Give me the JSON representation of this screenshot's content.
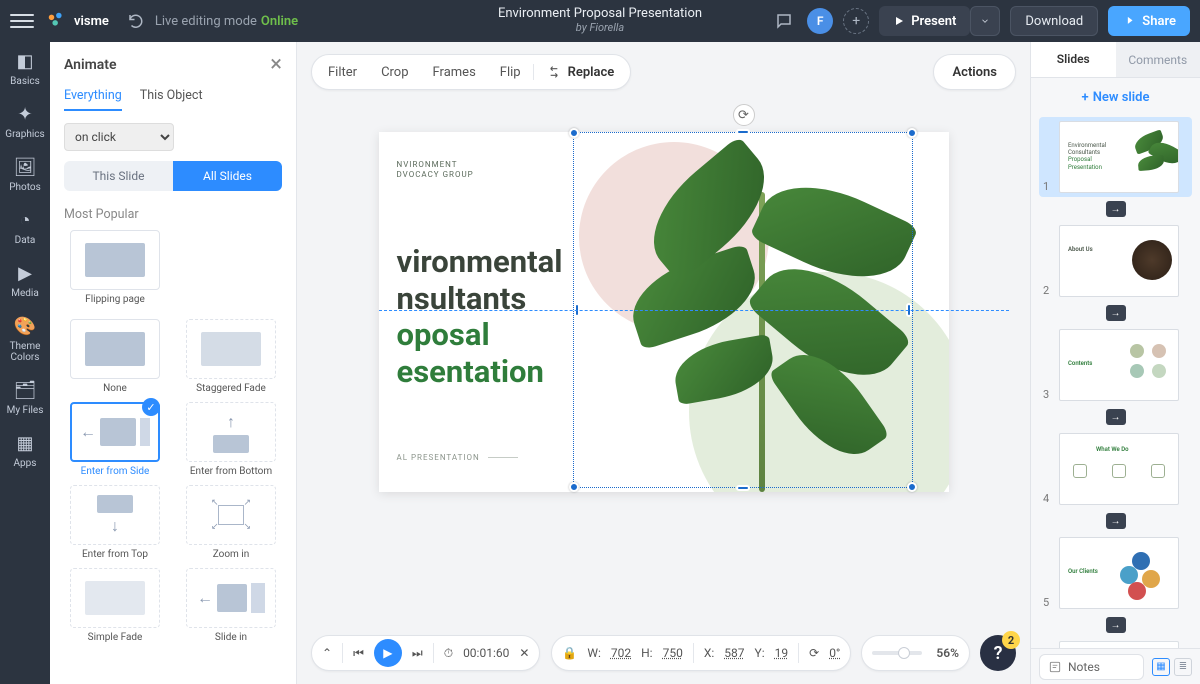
{
  "topbar": {
    "logo": "visme",
    "editing_mode_label": "Live editing mode",
    "editing_mode_status": "Online",
    "title": "Environment Proposal Presentation",
    "by_line": "by Fiorella",
    "avatar_initial": "F",
    "present": "Present",
    "download": "Download",
    "share": "Share"
  },
  "leftrail": {
    "items": [
      "Basics",
      "Graphics",
      "Photos",
      "Data",
      "Media",
      "Theme Colors",
      "My Files",
      "Apps"
    ]
  },
  "animate": {
    "head": "Animate",
    "tabs": {
      "everything": "Everything",
      "this_object": "This Object"
    },
    "trigger": "on click",
    "scope_this": "This Slide",
    "scope_all": "All Slides",
    "most_popular": "Most Popular",
    "cards": {
      "flipping": "Flipping page",
      "none": "None",
      "staggered": "Staggered Fade",
      "enter_side": "Enter from Side",
      "enter_bottom": "Enter from Bottom",
      "enter_top": "Enter from Top",
      "zoom_in": "Zoom in",
      "simple_fade": "Simple Fade",
      "slide_in": "Slide in"
    }
  },
  "toolbar": {
    "filter": "Filter",
    "crop": "Crop",
    "frames": "Frames",
    "flip": "Flip",
    "replace": "Replace",
    "actions": "Actions"
  },
  "slide": {
    "sub_line1": "NVIRONMENT",
    "sub_line2": "DVOCACY GROUP",
    "title1": "vironmental",
    "title2": "nsultants",
    "title3": "oposal",
    "title4": "esentation",
    "footer": "AL PRESENTATION"
  },
  "bottom": {
    "timer": "00:01:60",
    "w_label": "W:",
    "w_val": "702",
    "h_label": "H:",
    "h_val": "750",
    "x_label": "X:",
    "x_val": "587",
    "y_label": "Y:",
    "y_val": "19",
    "rot": "0°",
    "zoom": "56%",
    "help_badge": "2"
  },
  "right": {
    "tab_slides": "Slides",
    "tab_comments": "Comments",
    "new_slide": "New slide",
    "notes": "Notes",
    "slide_nums": [
      "1",
      "2",
      "3",
      "4",
      "5"
    ],
    "t1_l1": "Environmental",
    "t1_l2": "Consultants",
    "t1_l3": "Proposal",
    "t1_l4": "Presentation",
    "t2": "About Us",
    "t3": "Contents",
    "t4": "What We Do",
    "t5": "Our Clients"
  }
}
